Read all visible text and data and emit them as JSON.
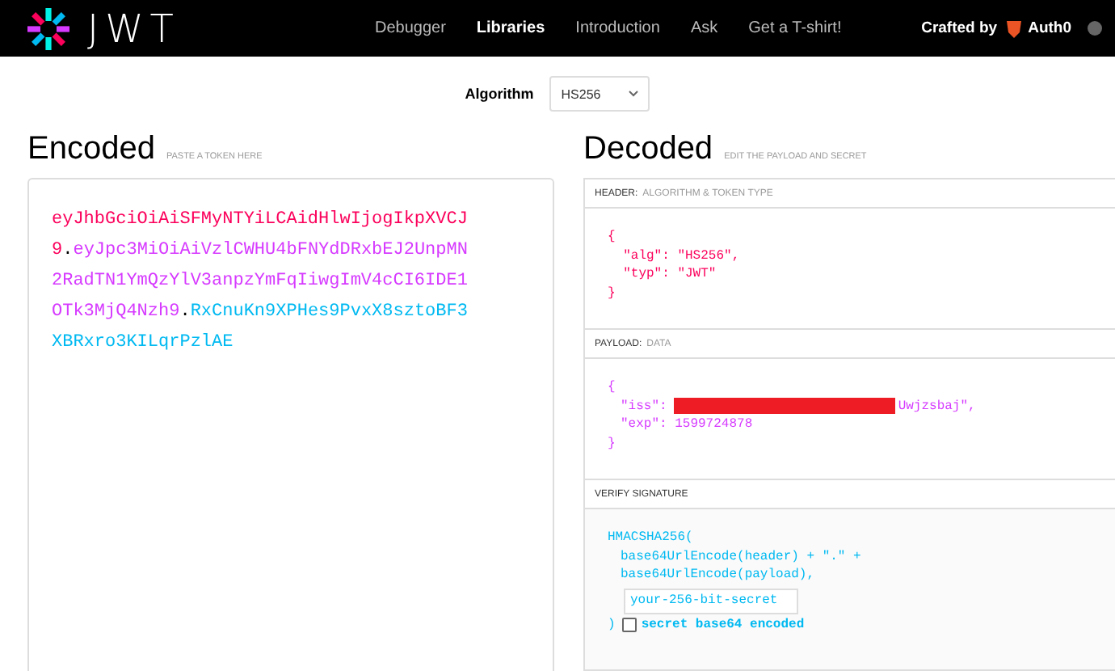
{
  "nav": {
    "brand": "JWT",
    "links": [
      {
        "label": "Debugger",
        "selected": false
      },
      {
        "label": "Libraries",
        "selected": true
      },
      {
        "label": "Introduction",
        "selected": false
      },
      {
        "label": "Ask",
        "selected": false
      },
      {
        "label": "Get a T-shirt!",
        "selected": false
      }
    ],
    "crafted_by": "Crafted by",
    "auth0": "Auth0"
  },
  "algorithm": {
    "label": "Algorithm",
    "value": "HS256"
  },
  "encoded": {
    "title": "Encoded",
    "hint": "PASTE A TOKEN HERE",
    "token": [
      {
        "kind": "header",
        "text": "eyJhbGciOiAiSFMyNTYiLCAidHlwIjogIkpXVCJ9"
      },
      {
        "kind": "dot",
        "text": "."
      },
      {
        "kind": "payload",
        "text": "eyJpc3MiOiAiVzlCWHU4bFNYdDRxbEJ2UnpMN2RadTN1YmQzYlV3anpzYmFqIiwgImV4cCI6IDE1OTk3MjQ4Nzh9"
      },
      {
        "kind": "dot",
        "text": "."
      },
      {
        "kind": "signature",
        "text": "RxCnuKn9XPHes9PvxX8sztoBF3XBRxro3KILqrPzlAE"
      }
    ]
  },
  "decoded": {
    "title": "Decoded",
    "hint": "EDIT THE PAYLOAD AND SECRET",
    "header": {
      "label": "HEADER:",
      "sublabel": "ALGORITHM & TOKEN TYPE",
      "lines": [
        "{",
        "  \"alg\": \"HS256\",",
        "  \"typ\": \"JWT\"",
        "}"
      ]
    },
    "payload": {
      "label": "PAYLOAD:",
      "sublabel": "DATA",
      "open": "{",
      "iss_key": "\"iss\":",
      "iss_tail": "Uwjzsbaj\",",
      "exp": "\"exp\": 1599724878",
      "close": "}"
    },
    "verify": {
      "label": "VERIFY SIGNATURE",
      "lines": [
        "HMACSHA256(",
        "base64UrlEncode(header) + \".\" +",
        "base64UrlEncode(payload),"
      ],
      "secret": "your-256-bit-secret",
      "close": ")",
      "base64_label": "secret base64 encoded",
      "base64_checked": false
    }
  }
}
